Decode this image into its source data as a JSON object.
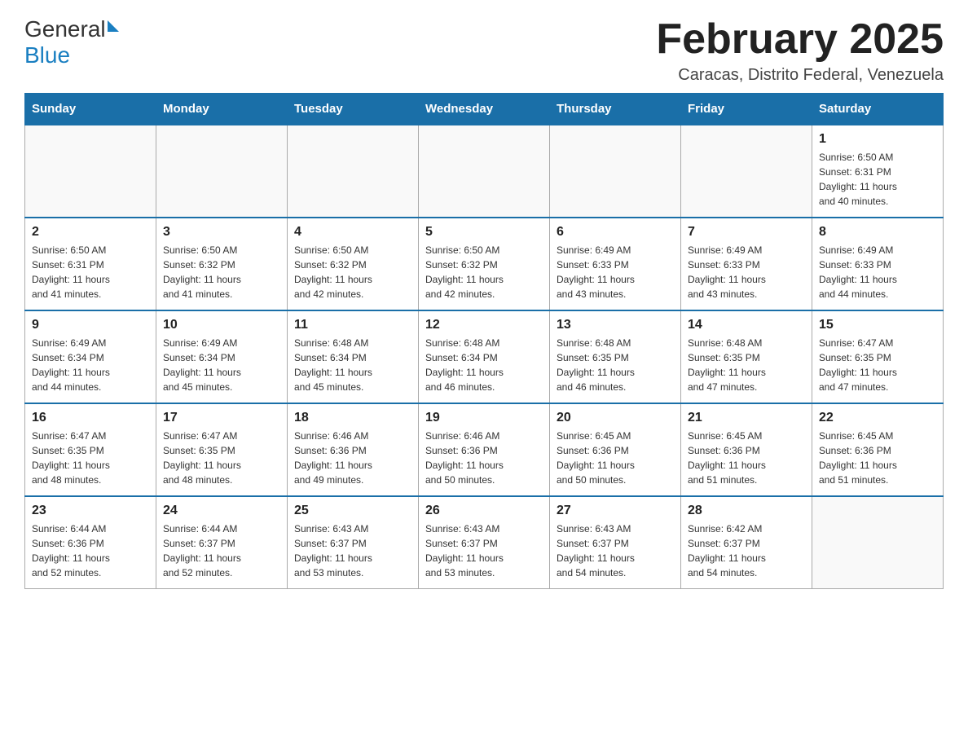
{
  "header": {
    "logo_general": "General",
    "logo_blue": "Blue",
    "month_title": "February 2025",
    "subtitle": "Caracas, Distrito Federal, Venezuela"
  },
  "days_of_week": [
    "Sunday",
    "Monday",
    "Tuesday",
    "Wednesday",
    "Thursday",
    "Friday",
    "Saturday"
  ],
  "weeks": [
    [
      {
        "day": "",
        "info": ""
      },
      {
        "day": "",
        "info": ""
      },
      {
        "day": "",
        "info": ""
      },
      {
        "day": "",
        "info": ""
      },
      {
        "day": "",
        "info": ""
      },
      {
        "day": "",
        "info": ""
      },
      {
        "day": "1",
        "info": "Sunrise: 6:50 AM\nSunset: 6:31 PM\nDaylight: 11 hours\nand 40 minutes."
      }
    ],
    [
      {
        "day": "2",
        "info": "Sunrise: 6:50 AM\nSunset: 6:31 PM\nDaylight: 11 hours\nand 41 minutes."
      },
      {
        "day": "3",
        "info": "Sunrise: 6:50 AM\nSunset: 6:32 PM\nDaylight: 11 hours\nand 41 minutes."
      },
      {
        "day": "4",
        "info": "Sunrise: 6:50 AM\nSunset: 6:32 PM\nDaylight: 11 hours\nand 42 minutes."
      },
      {
        "day": "5",
        "info": "Sunrise: 6:50 AM\nSunset: 6:32 PM\nDaylight: 11 hours\nand 42 minutes."
      },
      {
        "day": "6",
        "info": "Sunrise: 6:49 AM\nSunset: 6:33 PM\nDaylight: 11 hours\nand 43 minutes."
      },
      {
        "day": "7",
        "info": "Sunrise: 6:49 AM\nSunset: 6:33 PM\nDaylight: 11 hours\nand 43 minutes."
      },
      {
        "day": "8",
        "info": "Sunrise: 6:49 AM\nSunset: 6:33 PM\nDaylight: 11 hours\nand 44 minutes."
      }
    ],
    [
      {
        "day": "9",
        "info": "Sunrise: 6:49 AM\nSunset: 6:34 PM\nDaylight: 11 hours\nand 44 minutes."
      },
      {
        "day": "10",
        "info": "Sunrise: 6:49 AM\nSunset: 6:34 PM\nDaylight: 11 hours\nand 45 minutes."
      },
      {
        "day": "11",
        "info": "Sunrise: 6:48 AM\nSunset: 6:34 PM\nDaylight: 11 hours\nand 45 minutes."
      },
      {
        "day": "12",
        "info": "Sunrise: 6:48 AM\nSunset: 6:34 PM\nDaylight: 11 hours\nand 46 minutes."
      },
      {
        "day": "13",
        "info": "Sunrise: 6:48 AM\nSunset: 6:35 PM\nDaylight: 11 hours\nand 46 minutes."
      },
      {
        "day": "14",
        "info": "Sunrise: 6:48 AM\nSunset: 6:35 PM\nDaylight: 11 hours\nand 47 minutes."
      },
      {
        "day": "15",
        "info": "Sunrise: 6:47 AM\nSunset: 6:35 PM\nDaylight: 11 hours\nand 47 minutes."
      }
    ],
    [
      {
        "day": "16",
        "info": "Sunrise: 6:47 AM\nSunset: 6:35 PM\nDaylight: 11 hours\nand 48 minutes."
      },
      {
        "day": "17",
        "info": "Sunrise: 6:47 AM\nSunset: 6:35 PM\nDaylight: 11 hours\nand 48 minutes."
      },
      {
        "day": "18",
        "info": "Sunrise: 6:46 AM\nSunset: 6:36 PM\nDaylight: 11 hours\nand 49 minutes."
      },
      {
        "day": "19",
        "info": "Sunrise: 6:46 AM\nSunset: 6:36 PM\nDaylight: 11 hours\nand 50 minutes."
      },
      {
        "day": "20",
        "info": "Sunrise: 6:45 AM\nSunset: 6:36 PM\nDaylight: 11 hours\nand 50 minutes."
      },
      {
        "day": "21",
        "info": "Sunrise: 6:45 AM\nSunset: 6:36 PM\nDaylight: 11 hours\nand 51 minutes."
      },
      {
        "day": "22",
        "info": "Sunrise: 6:45 AM\nSunset: 6:36 PM\nDaylight: 11 hours\nand 51 minutes."
      }
    ],
    [
      {
        "day": "23",
        "info": "Sunrise: 6:44 AM\nSunset: 6:36 PM\nDaylight: 11 hours\nand 52 minutes."
      },
      {
        "day": "24",
        "info": "Sunrise: 6:44 AM\nSunset: 6:37 PM\nDaylight: 11 hours\nand 52 minutes."
      },
      {
        "day": "25",
        "info": "Sunrise: 6:43 AM\nSunset: 6:37 PM\nDaylight: 11 hours\nand 53 minutes."
      },
      {
        "day": "26",
        "info": "Sunrise: 6:43 AM\nSunset: 6:37 PM\nDaylight: 11 hours\nand 53 minutes."
      },
      {
        "day": "27",
        "info": "Sunrise: 6:43 AM\nSunset: 6:37 PM\nDaylight: 11 hours\nand 54 minutes."
      },
      {
        "day": "28",
        "info": "Sunrise: 6:42 AM\nSunset: 6:37 PM\nDaylight: 11 hours\nand 54 minutes."
      },
      {
        "day": "",
        "info": ""
      }
    ]
  ]
}
